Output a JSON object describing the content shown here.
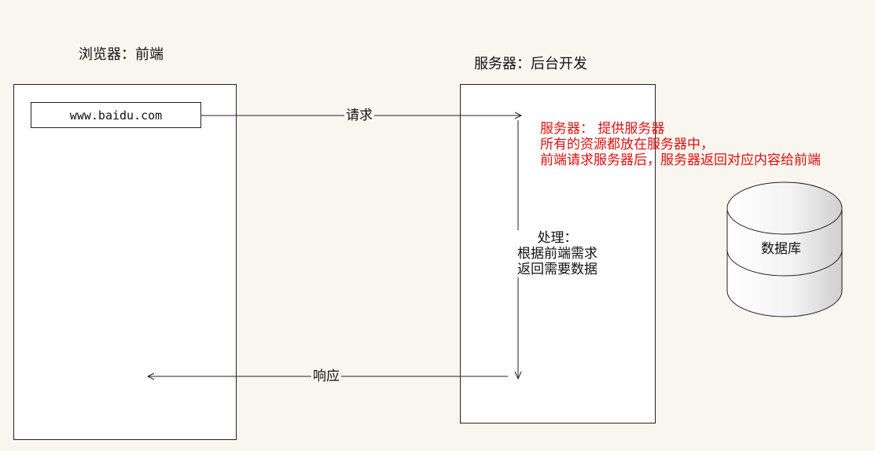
{
  "browser": {
    "title": "浏览器：前端",
    "url": "www.baidu.com"
  },
  "server": {
    "title": "服务器：后台开发",
    "notes": [
      "服务器：  提供服务器",
      "所有的资源都放在服务器中，",
      "前端请求服务器后，服务器返回对应内容给前端"
    ],
    "process_lines": [
      "处理：",
      "根据前端需求",
      "返回需要数据"
    ]
  },
  "arrows": {
    "request": "请求",
    "response": "响应"
  },
  "database": {
    "label": "数据库"
  },
  "colors": {
    "background": "#f9f6ef",
    "note": "#e01010",
    "line": "#222222"
  }
}
